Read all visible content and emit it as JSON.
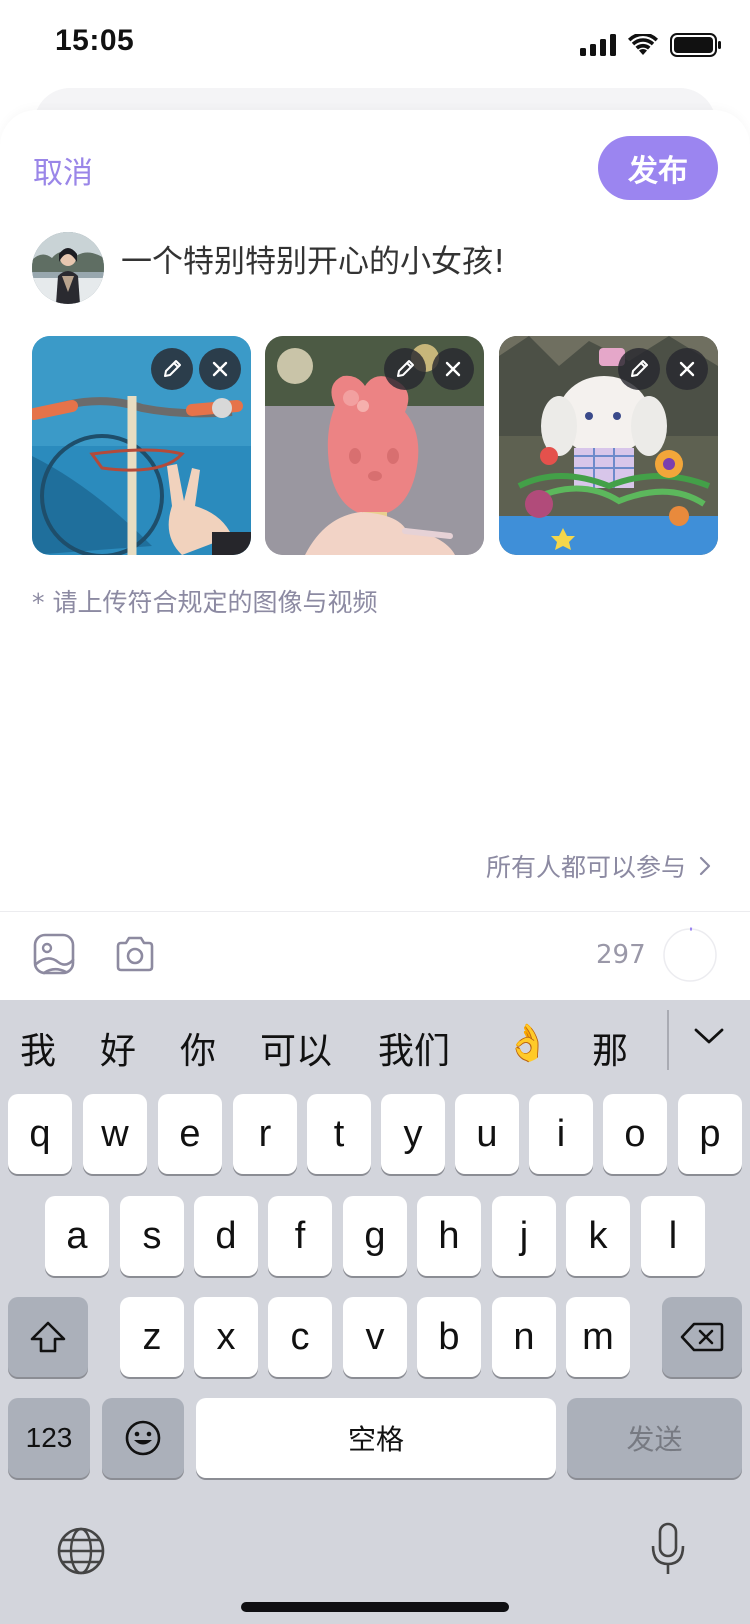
{
  "status": {
    "time": "15:05"
  },
  "header": {
    "cancel": "取消",
    "publish": "发布"
  },
  "post": {
    "text": "一个特别特别开心的小女孩!"
  },
  "photos": [
    {
      "name": "bicycle-photo"
    },
    {
      "name": "popsicle-photo"
    },
    {
      "name": "bunny-figure-photo"
    }
  ],
  "hint": "* 请上传符合规定的图像与视频",
  "visibility": "所有人都可以参与",
  "toolbar": {
    "remaining": "297"
  },
  "keyboard": {
    "candidates": [
      "我",
      "好",
      "你",
      "可以",
      "我们",
      "👌",
      "那"
    ],
    "row1": [
      "q",
      "w",
      "e",
      "r",
      "t",
      "y",
      "u",
      "i",
      "o",
      "p"
    ],
    "row2": [
      "a",
      "s",
      "d",
      "f",
      "g",
      "h",
      "j",
      "k",
      "l"
    ],
    "row3": [
      "z",
      "x",
      "c",
      "v",
      "b",
      "n",
      "m"
    ],
    "numbers": "123",
    "space": "空格",
    "send": "发送"
  },
  "colors": {
    "accent": "#9b85f0",
    "hint": "#8c8aa2",
    "keyboard_bg": "#d3d5dc"
  },
  "icons": [
    "signal-icon",
    "wifi-icon",
    "battery-icon",
    "pencil-icon",
    "close-icon",
    "chevron-right-icon",
    "image-icon",
    "camera-icon",
    "chevron-down-icon",
    "shift-icon",
    "backspace-icon",
    "emoji-icon",
    "globe-icon",
    "microphone-icon"
  ]
}
